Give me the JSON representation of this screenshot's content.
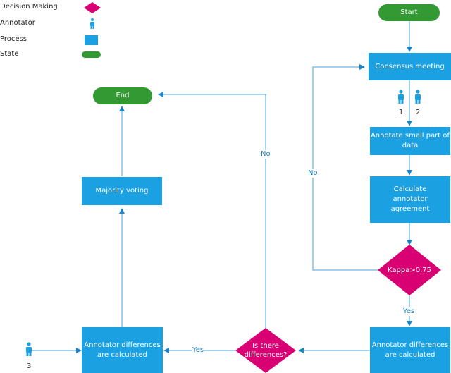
{
  "legend": {
    "items": [
      {
        "label": "Decision Making",
        "icon": "diamond-icon"
      },
      {
        "label": "Annotator",
        "icon": "person-icon"
      },
      {
        "label": "Process",
        "icon": "rectangle-icon"
      },
      {
        "label": "State",
        "icon": "rounded-pill-icon"
      }
    ]
  },
  "colors": {
    "decision": "#d80073",
    "process": "#1ba1e2",
    "state": "#339933",
    "connector": "#6cb8e6",
    "arrow": "#1a86c9",
    "label": "#1a7fc0"
  },
  "nodes": {
    "start": "Start",
    "consensus": "Consensus meeting",
    "annotate_small": "Annotate small part of data",
    "calc_agreement": "Calculate annotator agreement",
    "kappa": "Kappa>0.75",
    "diff_right": "Annotator differences are calculated",
    "is_there_diff": "Is there differences?",
    "diff_left": "Annotator differences are calculated",
    "majority": "Majority voting",
    "end": "End"
  },
  "annotators": {
    "a1": "1",
    "a2": "2",
    "a3": "3"
  },
  "edge_labels": {
    "kappa_no": "No",
    "kappa_yes": "Yes",
    "diff_yes": "Yes",
    "diff_no": "No"
  }
}
